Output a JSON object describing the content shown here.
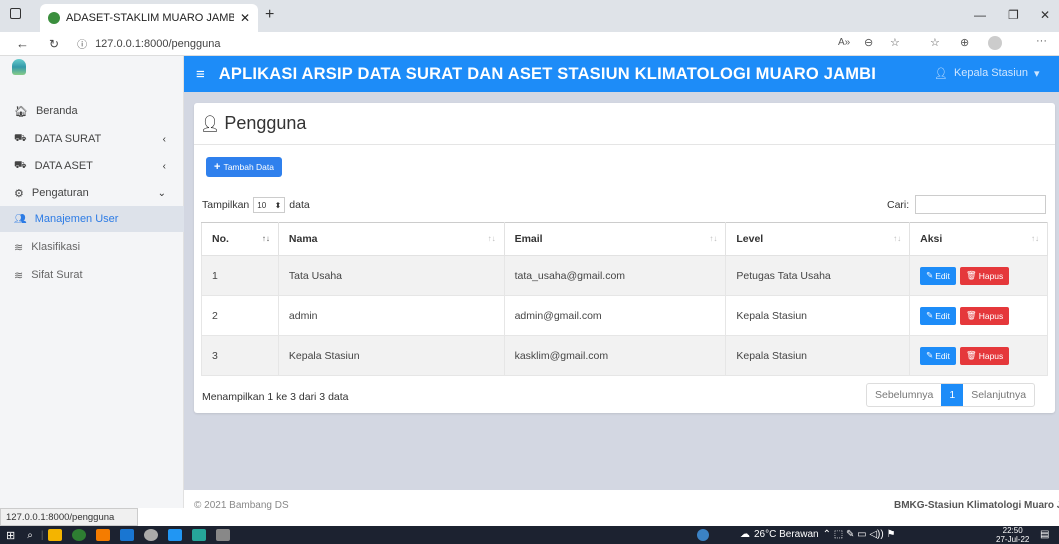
{
  "browser": {
    "tab_title": "ADASET-STAKLIM MUARO JAMB",
    "url": "127.0.0.1:8000/pengguna",
    "status_url": "127.0.0.1:8000/pengguna"
  },
  "app": {
    "title": "APLIKASI ARSIP DATA SURAT DAN ASET STASIUN KLIMATOLOGI MUARO JAMBI",
    "user": "Kepala Stasiun"
  },
  "sidebar": {
    "items": [
      {
        "label": "Beranda",
        "icon": "home-icon"
      },
      {
        "label": "DATA SURAT",
        "icon": "truck-icon"
      },
      {
        "label": "DATA ASET",
        "icon": "truck-icon"
      },
      {
        "label": "Pengaturan",
        "icon": "gears-icon"
      },
      {
        "label": "Manajemen User",
        "icon": "users-icon"
      },
      {
        "label": "Klasifikasi",
        "icon": "layers-icon"
      },
      {
        "label": "Sifat Surat",
        "icon": "layers-icon"
      }
    ]
  },
  "page": {
    "heading": "Pengguna",
    "add_button": "Tambah Data",
    "show_label": "Tampilkan",
    "show_value": "10",
    "show_suffix": "data",
    "search_label": "Cari:"
  },
  "table": {
    "headers": [
      "No.",
      "Nama",
      "Email",
      "Level",
      "Aksi"
    ],
    "rows": [
      {
        "no": "1",
        "nama": "Tata Usaha",
        "email": "tata_usaha@gmail.com",
        "level": "Petugas Tata Usaha"
      },
      {
        "no": "2",
        "nama": "admin",
        "email": "admin@gmail.com",
        "level": "Kepala Stasiun"
      },
      {
        "no": "3",
        "nama": "Kepala Stasiun",
        "email": "kasklim@gmail.com",
        "level": "Kepala Stasiun"
      }
    ],
    "edit_label": "Edit",
    "delete_label": "Hapus",
    "info": "Menampilkan 1 ke 3 dari 3 data",
    "prev": "Sebelumnya",
    "page": "1",
    "next": "Selanjutnya"
  },
  "footer": {
    "left": "© 2021 Bambang DS",
    "right": "BMKG-Stasiun Klimatologi Muaro Jambi"
  },
  "taskbar": {
    "weather": "26°C Berawan",
    "time": "22:50",
    "date": "27-Jul-22"
  },
  "colors": {
    "primary": "#1d8cf8",
    "danger": "#e5383b",
    "background": "#d3d7e2"
  }
}
